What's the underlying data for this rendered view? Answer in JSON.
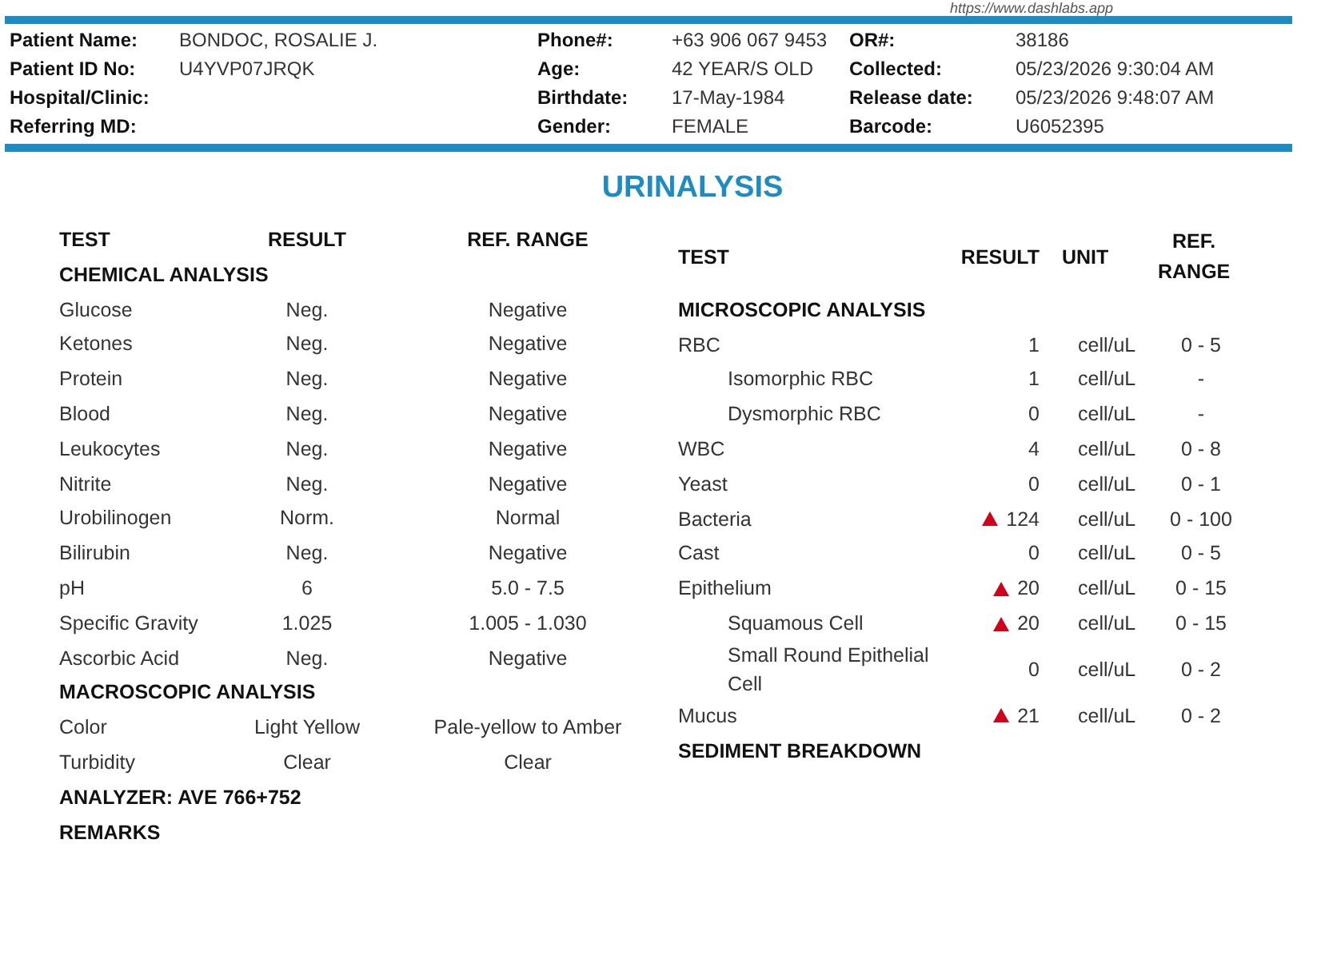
{
  "site_url": "https://www.dashlabs.app",
  "patient": [
    {
      "label": "Patient Name:",
      "value": "BONDOC, ROSALIE J."
    },
    {
      "label": "Phone#:",
      "value": "+63 906 067 9453"
    },
    {
      "label": "OR#:",
      "value": "38186"
    },
    {
      "label": "Patient ID No:",
      "value": "U4YVP07JRQK"
    },
    {
      "label": "Age:",
      "value": "42 YEAR/S OLD"
    },
    {
      "label": "Collected:",
      "value": "05/23/2026 9:30:04 AM"
    },
    {
      "label": "Hospital/Clinic:"
    },
    {
      "label": "Birthdate:",
      "value": "17-May-1984"
    },
    {
      "label": "Release date:",
      "value": "05/23/2026 9:48:07 AM"
    },
    {
      "label": "Referring MD:"
    },
    {
      "label": "Gender:",
      "value": "FEMALE"
    },
    {
      "label": "Barcode:",
      "value": "U6052395"
    }
  ],
  "title": "URINALYSIS",
  "left_table": {
    "columns": [
      "TEST",
      "RESULT",
      "REF. RANGE"
    ],
    "sections": [
      {
        "title": "CHEMICAL ANALYSIS",
        "rows": [
          {
            "test": "Glucose",
            "result": "Neg.",
            "range": "Negative"
          },
          {
            "test": "Ketones",
            "result": "Neg.",
            "range": "Negative"
          },
          {
            "test": "Protein",
            "result": "Neg.",
            "range": "Negative"
          },
          {
            "test": "Blood",
            "result": "Neg.",
            "range": "Negative"
          },
          {
            "test": "Leukocytes",
            "result": "Neg.",
            "range": "Negative"
          },
          {
            "test": "Nitrite",
            "result": "Neg.",
            "range": "Negative"
          },
          {
            "test": "Urobilinogen",
            "result": "Norm.",
            "range": "Normal"
          },
          {
            "test": "Bilirubin",
            "result": "Neg.",
            "range": "Negative"
          },
          {
            "test": "pH",
            "result": "6",
            "range": "5.0 - 7.5"
          },
          {
            "test": "Specific Gravity",
            "result": "1.025",
            "range": "1.005 - 1.030"
          },
          {
            "test": "Ascorbic Acid",
            "result": "Neg.",
            "range": "Negative"
          }
        ]
      },
      {
        "title": "MACROSCOPIC ANALYSIS",
        "rows": [
          {
            "test": "Color",
            "result": "Light Yellow",
            "range": "Pale-yellow to Amber"
          },
          {
            "test": "Turbidity",
            "result": "Clear",
            "range": "Clear"
          }
        ]
      }
    ],
    "notes": [
      "ANALYZER: AVE 766+752",
      "REMARKS"
    ]
  },
  "right_table": {
    "columns": [
      "TEST",
      "RESULT",
      "UNIT",
      "REF. RANGE"
    ],
    "section_title": "MICROSCOPIC ANALYSIS",
    "rows": [
      {
        "test": "RBC",
        "result": "1",
        "unit": "cell/uL",
        "range": "0 - 5",
        "flag": false,
        "children": [
          {
            "test": "Isomorphic RBC",
            "result": "1",
            "unit": "cell/uL",
            "range": "-",
            "flag": false
          },
          {
            "test": "Dysmorphic RBC",
            "result": "0",
            "unit": "cell/uL",
            "range": "-",
            "flag": false
          }
        ]
      },
      {
        "test": "WBC",
        "result": "4",
        "unit": "cell/uL",
        "range": "0 - 8",
        "flag": false
      },
      {
        "test": "Yeast",
        "result": "0",
        "unit": "cell/uL",
        "range": "0 - 1",
        "flag": false
      },
      {
        "test": "Bacteria",
        "result": "124",
        "unit": "cell/uL",
        "range": "0 - 100",
        "flag": true
      },
      {
        "test": "Cast",
        "result": "0",
        "unit": "cell/uL",
        "range": "0 - 5",
        "flag": false
      },
      {
        "test": "Epithelium",
        "result": "20",
        "unit": "cell/uL",
        "range": "0 - 15",
        "flag": true,
        "children": [
          {
            "test": "Squamous Cell",
            "result": "20",
            "unit": "cell/uL",
            "range": "0 - 15",
            "flag": true
          },
          {
            "test": "Small Round Epithelial Cell",
            "result": "0",
            "unit": "cell/uL",
            "range": "0 - 2",
            "flag": false
          }
        ]
      },
      {
        "test": "Mucus",
        "result": "21",
        "unit": "cell/uL",
        "range": "0 - 2",
        "flag": true
      }
    ],
    "footer_title": "SEDIMENT BREAKDOWN"
  }
}
